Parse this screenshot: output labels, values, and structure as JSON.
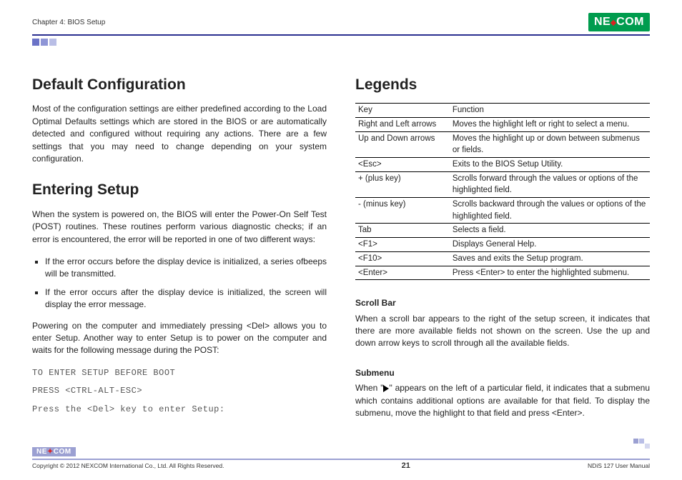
{
  "header": {
    "chapter": "Chapter 4: BIOS Setup",
    "logo_left": "NE",
    "logo_right": "COM"
  },
  "left": {
    "h1a": "Default Configuration",
    "p1": "Most of the configuration settings are either predefined according to the Load Optimal Defaults settings which are stored in the BIOS or are automatically detected and configured without requiring any actions. There are a few settings that you may need to change depending on your system configuration.",
    "h1b": "Entering Setup",
    "p2": "When the system is powered on, the BIOS will enter the Power-On Self Test (POST) routines. These routines perform various diagnostic checks; if an error is encountered, the error will be reported in one of two different ways:",
    "li1": "If the error occurs before the display device is initialized, a series ofbeeps will be transmitted.",
    "li2": "If the error occurs after the display device is initialized, the screen will display the error message.",
    "p3": "Powering on the computer and immediately pressing <Del> allows you to enter Setup. Another way to enter Setup is to power on the computer and waits for the following message during the POST:",
    "m1": "TO ENTER SETUP BEFORE BOOT",
    "m2": "PRESS <CTRL-ALT-ESC>",
    "m3": "Press the <Del> key to enter Setup:"
  },
  "right": {
    "h1": "Legends",
    "thead_key": "Key",
    "thead_fn": "Function",
    "rows": [
      [
        "Right and Left arrows",
        "Moves the highlight left or right to select a menu."
      ],
      [
        "Up and Down arrows",
        "Moves the highlight up or down between submenus or fields."
      ],
      [
        "<Esc>",
        "Exits to the BIOS Setup Utility."
      ],
      [
        "+ (plus key)",
        "Scrolls forward through the values or options of the highlighted field."
      ],
      [
        "- (minus key)",
        "Scrolls backward through the values or options of the highlighted field."
      ],
      [
        "Tab",
        "Selects a field."
      ],
      [
        "<F1>",
        "Displays General Help."
      ],
      [
        "<F10>",
        "Saves and exits the Setup program."
      ],
      [
        "<Enter>",
        "Press <Enter> to enter the highlighted submenu."
      ]
    ],
    "sub1": "Scroll Bar",
    "sub1p": "When a scroll bar appears to the right of the setup screen, it indicates that there are more available fields not shown on the screen. Use the up and down arrow keys to scroll through all the available fields.",
    "sub2": "Submenu",
    "sub2p_a": "When \"",
    "sub2p_b": "\" appears on the left of a particular field, it indicates that a submenu which contains additional options are available for that field. To display the submenu, move the highlight to that field and press <Enter>."
  },
  "footer": {
    "copyright": "Copyright © 2012 NEXCOM International Co., Ltd. All Rights Reserved.",
    "page": "21",
    "manual": "NDiS 127 User Manual",
    "logo_left": "NE",
    "logo_right": "COM"
  }
}
